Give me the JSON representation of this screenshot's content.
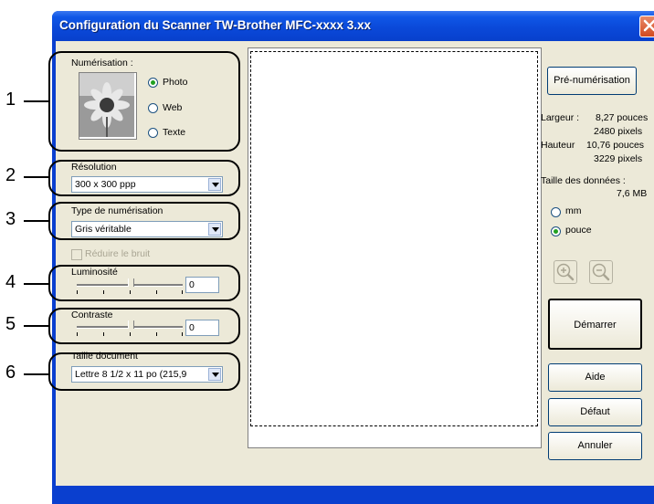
{
  "window": {
    "title": "Configuration du Scanner TW-Brother MFC-xxxx   3.xx",
    "close_icon": "close-icon"
  },
  "callouts": [
    "1",
    "2",
    "3",
    "4",
    "5",
    "6"
  ],
  "scan_mode": {
    "label": "Numérisation :",
    "options": [
      {
        "label": "Photo",
        "selected": true
      },
      {
        "label": "Web",
        "selected": false
      },
      {
        "label": "Texte",
        "selected": false
      }
    ]
  },
  "resolution": {
    "label": "Résolution",
    "value": "300 x 300 ppp"
  },
  "scan_type": {
    "label": "Type de numérisation",
    "value": "Gris véritable"
  },
  "noise_reduction": {
    "label": "Réduire le bruit",
    "checked": false,
    "enabled": false
  },
  "brightness": {
    "label": "Luminosité",
    "value": "0"
  },
  "contrast": {
    "label": "Contraste",
    "value": "0"
  },
  "document_size": {
    "label": "Taille document",
    "value": "Lettre 8 1/2 x 11 po (215,9"
  },
  "prescan_button": "Pré-numérisation",
  "info": {
    "width_label": "Largeur :",
    "width_value": "8,27 pouces",
    "width_pixels": "2480 pixels",
    "height_label": "Hauteur",
    "height_value": "10,76 pouces",
    "height_pixels": "3229 pixels",
    "data_size_label": "Taille des données :",
    "data_size_value": "7,6 MB"
  },
  "units": {
    "options": [
      {
        "label": "mm",
        "selected": false
      },
      {
        "label": "pouce",
        "selected": true
      }
    ]
  },
  "zoom_icons": [
    "zoom-in-icon",
    "zoom-out-icon"
  ],
  "buttons": {
    "start": "Démarrer",
    "help": "Aide",
    "default": "Défaut",
    "cancel": "Annuler"
  }
}
